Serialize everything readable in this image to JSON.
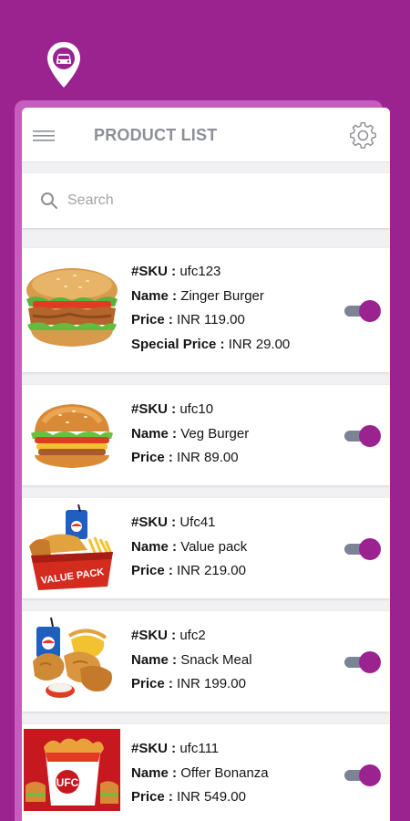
{
  "app": {
    "brand_color": "#9b2390",
    "logo_icon": "car-location-pin-icon"
  },
  "header": {
    "title": "PRODUCT LIST",
    "menu_icon": "hamburger-menu-icon",
    "settings_icon": "gear-icon"
  },
  "search": {
    "placeholder": "Search",
    "value": ""
  },
  "products": [
    {
      "sku_label": "#SKU : ",
      "sku": "ufc123",
      "name_label": "Name : ",
      "name": "Zinger Burger",
      "price_label": "Price : ",
      "price": "INR 119.00",
      "special_label": "Special Price : ",
      "special_price": "INR 29.00",
      "enabled": true,
      "image": "zinger-burger"
    },
    {
      "sku_label": "#SKU : ",
      "sku": "ufc10",
      "name_label": "Name : ",
      "name": "Veg Burger",
      "price_label": "Price : ",
      "price": "INR 89.00",
      "enabled": true,
      "image": "veg-burger"
    },
    {
      "sku_label": "#SKU : ",
      "sku": "Ufc41",
      "name_label": "Name : ",
      "name": "Value pack",
      "price_label": "Price : ",
      "price": "INR 219.00",
      "enabled": true,
      "image": "value-pack",
      "image_text": "VALUE PACK"
    },
    {
      "sku_label": "#SKU : ",
      "sku": "ufc2",
      "name_label": "Name : ",
      "name": "Snack Meal",
      "price_label": "Price : ",
      "price": "INR 199.00",
      "enabled": true,
      "image": "snack-meal"
    },
    {
      "sku_label": "#SKU : ",
      "sku": "ufc111",
      "name_label": "Name : ",
      "name": "Offer Bonanza",
      "price_label": "Price : ",
      "price": "INR 549.00",
      "enabled": true,
      "image": "offer-bonanza",
      "image_text": "UFC"
    }
  ]
}
